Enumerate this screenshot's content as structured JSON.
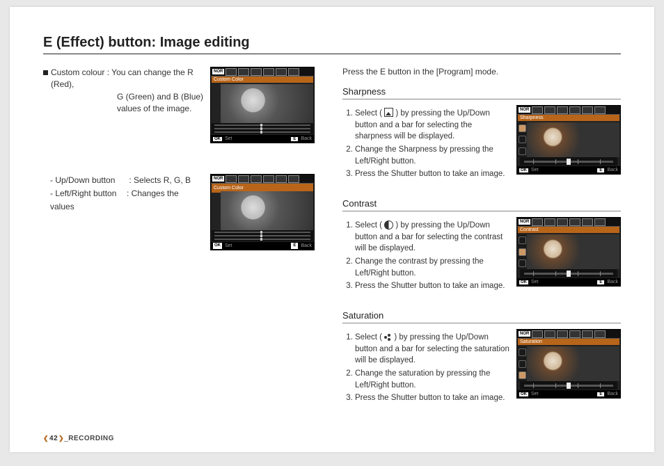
{
  "title": "E (Effect) button: Image editing",
  "custom_colour": {
    "label": "Custom colour",
    "sep": " : ",
    "line1": "You can change the R (Red),",
    "line2": "G (Green) and B (Blue)",
    "line3": "values of the image.",
    "updown_label": "- Up/Down button",
    "updown_sep": " : ",
    "updown_desc": "Selects R, G, B",
    "leftright_label": "- Left/Right button",
    "leftright_sep": ": ",
    "leftright_desc": "Changes the values"
  },
  "lcd": {
    "nor": "NOR",
    "ok": "OK",
    "set": "Set",
    "e": "E",
    "back": "Back",
    "custom_color": "Custom Color",
    "sharpness": "Sharpness",
    "contrast": "Contrast",
    "saturation": "Saturation"
  },
  "right": {
    "intro": "Press the E button in the [Program] mode.",
    "sharpness": {
      "head": "Sharpness",
      "s1a": "Select ( ",
      "s1b": " ) by pressing the Up/Down button and a bar for selecting the sharpness will be displayed.",
      "s2": "Change the Sharpness by pressing the Left/Right button.",
      "s3": "Press the Shutter button to take an image."
    },
    "contrast": {
      "head": "Contrast",
      "s1a": "Select ( ",
      "s1b": " ) by pressing the Up/Down button and a bar for selecting the contrast will be displayed.",
      "s2": "Change the contrast by pressing the Left/Right button.",
      "s3": "Press the Shutter button to take an image."
    },
    "saturation": {
      "head": "Saturation",
      "s1a": "Select ( ",
      "s1b": " ) by pressing the Up/Down button and a bar for selecting the saturation will be displayed.",
      "s2": "Change the saturation by pressing the Left/Right button.",
      "s3": "Press the Shutter button to take an image."
    }
  },
  "footer": {
    "page": "42",
    "sep": "_",
    "section": "RECORDING"
  }
}
